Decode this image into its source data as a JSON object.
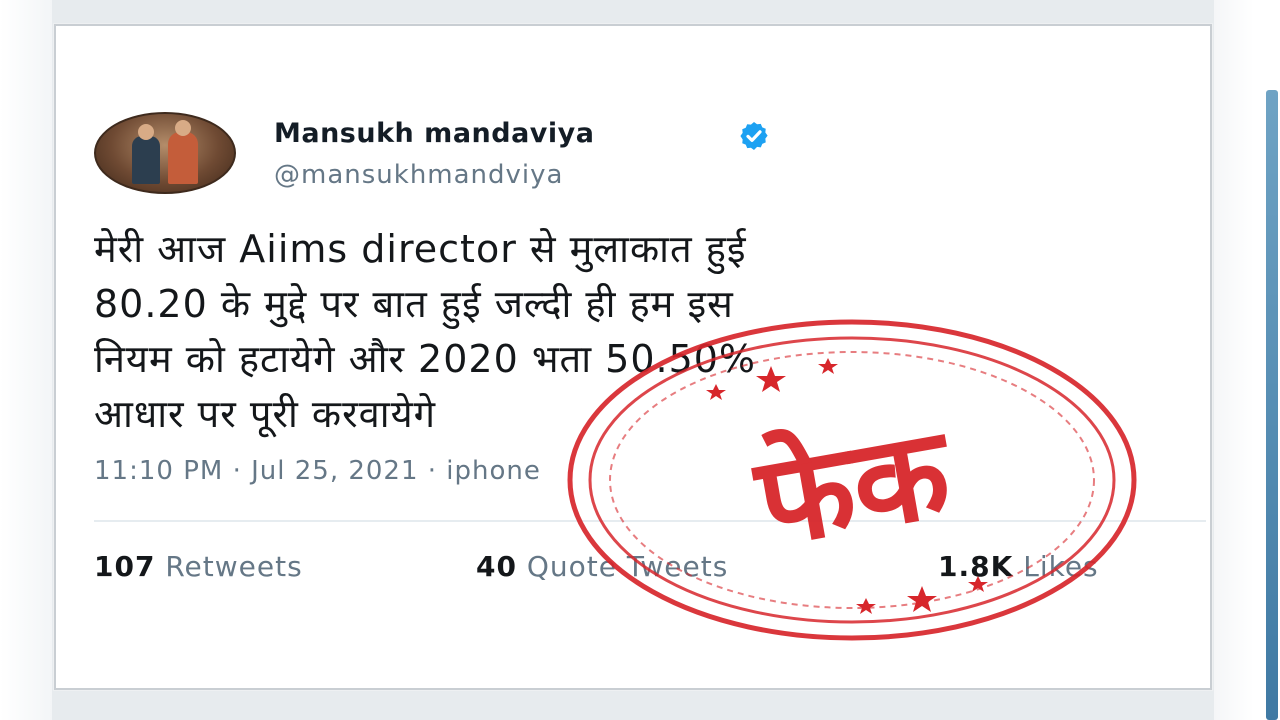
{
  "tweet": {
    "display_name": "Mansukh mandaviya",
    "handle": "@mansukhmandviya",
    "text_lines": [
      "मेरी आज Aiims director से मुलाकात हुई",
      "80.20 के मुद्दे पर बात हुई जल्दी ही हम इस",
      "नियम को हटायेगे और 2020 भता 50.50%",
      "आधार पर पूरी करवायेगे"
    ],
    "timestamp": "11:10 PM · Jul 25, 2021 · iphone"
  },
  "stats": {
    "retweets_count": "107",
    "retweets_label": "Retweets",
    "quotes_count": "40",
    "quotes_label": "Quote Tweets",
    "likes_count": "1.8K",
    "likes_label": "Likes"
  },
  "stamp": {
    "text": "फेक",
    "color": "#d7262b"
  },
  "icons": {
    "verified": "verified-badge-icon"
  },
  "colors": {
    "verified_blue": "#1da1f2",
    "text_dark": "#14171a",
    "text_gray": "#657786"
  }
}
